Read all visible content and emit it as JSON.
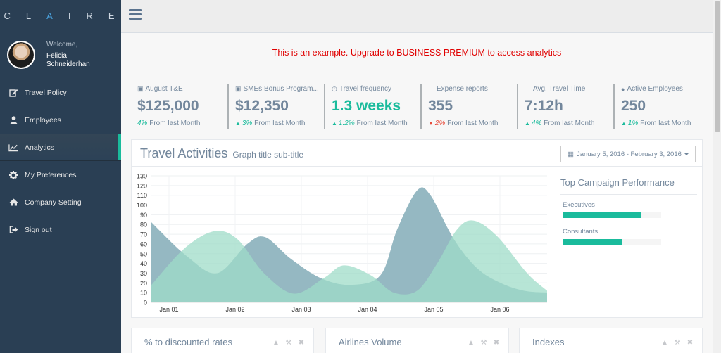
{
  "sidebar": {
    "logo_letters": [
      "C",
      "L",
      "A",
      "I",
      "R",
      "E"
    ],
    "profile": {
      "welcome": "Welcome,",
      "name_line1": "Felicia",
      "name_line2": "Schneiderhan"
    },
    "items": [
      {
        "label": "Travel Policy",
        "icon": "edit-icon"
      },
      {
        "label": "Employees",
        "icon": "user-icon"
      },
      {
        "label": "Analytics",
        "icon": "line-chart-icon"
      },
      {
        "label": "My Preferences",
        "icon": "gear-icon"
      },
      {
        "label": "Company Setting",
        "icon": "home-icon"
      },
      {
        "label": "Sign out",
        "icon": "sign-out-icon"
      }
    ],
    "active_index": 2
  },
  "topbar": {
    "menu_icon": "hamburger-icon"
  },
  "notice": "This is an example. Upgrade to BUSINESS PREMIUM to access analytics",
  "tiles": [
    {
      "icon": "card-icon",
      "label": "August T&E",
      "value": "$125,000",
      "pct": "4%",
      "foot": "From last Month",
      "trend": "none",
      "value_color": "#73879c"
    },
    {
      "icon": "card-icon",
      "label": "SMEs Bonus Program...",
      "value": "$12,350",
      "pct": "3%",
      "foot": "From last Month",
      "trend": "up",
      "value_color": "#73879c"
    },
    {
      "icon": "clock-icon",
      "label": "Travel frequency",
      "value": "1.3 weeks",
      "pct": "1.2%",
      "foot": "From last Month",
      "trend": "up",
      "value_color": "#1abb9c"
    },
    {
      "icon": "",
      "label": "Expense reports",
      "value": "355",
      "pct": "2%",
      "foot": "From last Month",
      "trend": "down",
      "value_color": "#73879c"
    },
    {
      "icon": "",
      "label": "Avg. Travel Time",
      "value": "7:12h",
      "pct": "4%",
      "foot": "From last Month",
      "trend": "up",
      "value_color": "#73879c"
    },
    {
      "icon": "user-icon",
      "label": "Active Employees",
      "value": "250",
      "pct": "1%",
      "foot": "From last Month",
      "trend": "up",
      "value_color": "#73879c"
    }
  ],
  "graph": {
    "title": "Travel Activities",
    "subtitle": "Graph title sub-title",
    "date_range": "January 5, 2016 - February 3, 2016"
  },
  "chart_data": {
    "type": "area",
    "x": [
      "Jan 01",
      "Jan 02",
      "Jan 03",
      "Jan 04",
      "Jan 05",
      "Jan 06"
    ],
    "ylim": [
      0,
      130
    ],
    "yticks": [
      0,
      10,
      20,
      30,
      40,
      50,
      60,
      70,
      80,
      90,
      100,
      110,
      120,
      130
    ],
    "grid": true,
    "series": [
      {
        "color": "#8fb4bf",
        "points": [
          [
            0.0,
            83
          ],
          [
            0.55,
            47
          ],
          [
            1.0,
            30
          ],
          [
            1.45,
            60
          ],
          [
            1.72,
            67
          ],
          [
            2.1,
            45
          ],
          [
            2.55,
            25
          ],
          [
            3.0,
            18
          ],
          [
            3.45,
            28
          ],
          [
            3.7,
            75
          ],
          [
            4.0,
            115
          ],
          [
            4.2,
            110
          ],
          [
            4.55,
            65
          ],
          [
            4.9,
            35
          ],
          [
            5.25,
            20
          ],
          [
            5.6,
            12
          ],
          [
            5.95,
            10
          ]
        ]
      },
      {
        "color": "#9fdcc8",
        "points": [
          [
            0.0,
            17
          ],
          [
            0.5,
            55
          ],
          [
            0.95,
            73
          ],
          [
            1.3,
            65
          ],
          [
            1.7,
            30
          ],
          [
            2.15,
            9
          ],
          [
            2.6,
            25
          ],
          [
            2.9,
            38
          ],
          [
            3.3,
            28
          ],
          [
            3.65,
            10
          ],
          [
            4.0,
            12
          ],
          [
            4.3,
            40
          ],
          [
            4.6,
            75
          ],
          [
            4.85,
            84
          ],
          [
            5.2,
            68
          ],
          [
            5.65,
            30
          ],
          [
            5.95,
            12
          ]
        ]
      }
    ]
  },
  "campaign": {
    "title": "Top Campaign Performance",
    "items": [
      {
        "label": "Executives",
        "value": 0.8
      },
      {
        "label": "Consultants",
        "value": 0.6
      }
    ]
  },
  "bottom_panels": [
    {
      "title": "% to discounted rates"
    },
    {
      "title": "Airlines Volume"
    },
    {
      "title": "Indexes"
    }
  ],
  "colors": {
    "sidebar": "#2a3f54",
    "accent": "#1abb9c",
    "text": "#73879c",
    "alert": "#e00000"
  }
}
